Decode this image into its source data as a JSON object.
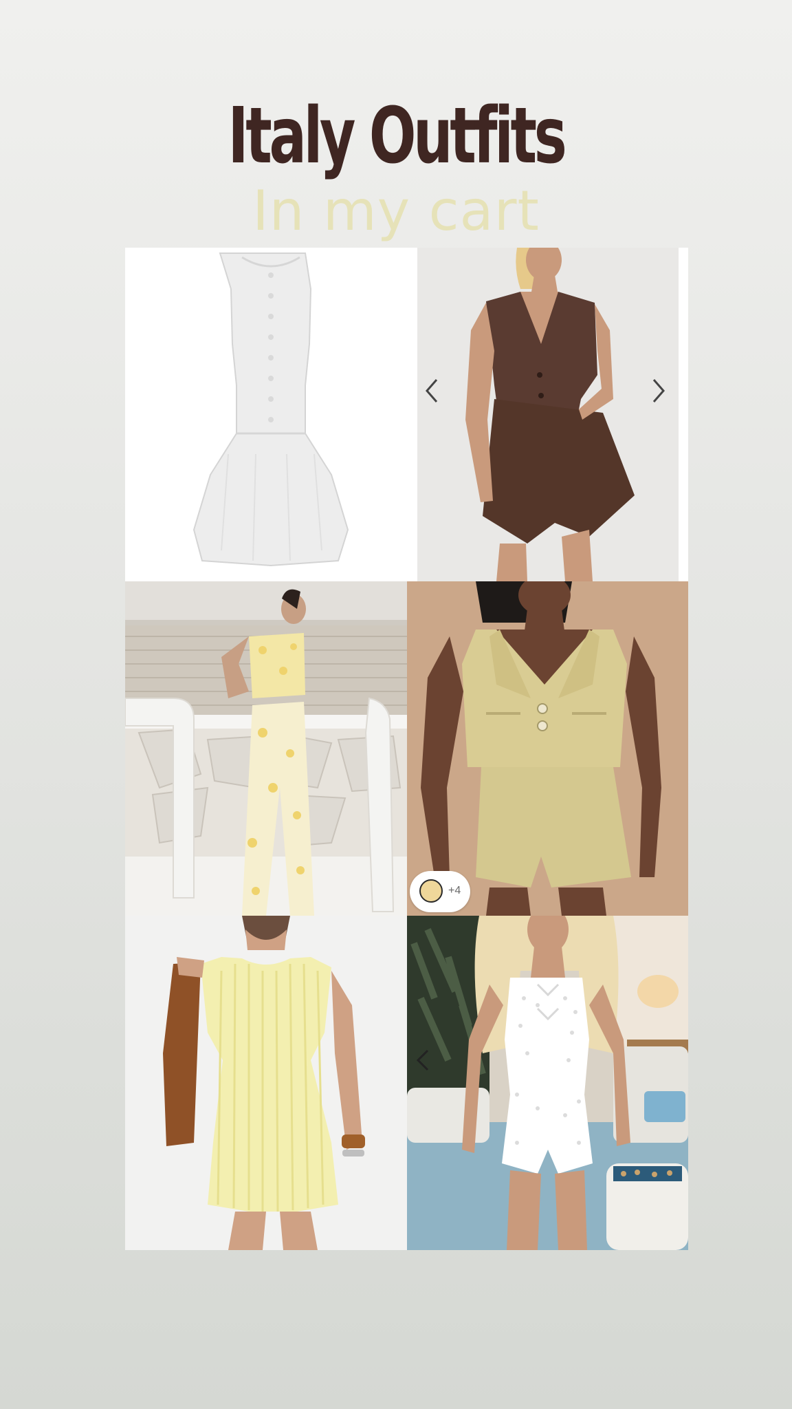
{
  "header": {
    "title": "Italy Outfits",
    "subtitle": "In my cart"
  },
  "colors": {
    "title": "#3f2622",
    "subtitle": "#e6e2b8",
    "background_top": "#f0f0ee",
    "background_bottom": "#d5d8d3"
  },
  "products": [
    {
      "name": "white sleeveless button-front mini dress",
      "icon": "product-photo"
    },
    {
      "name": "brown vest and shorts set",
      "icon": "product-photo",
      "carousel": true
    },
    {
      "name": "yellow floral tube top and wide-leg pants set",
      "icon": "product-photo"
    },
    {
      "name": "beige tweed vest and shorts set",
      "icon": "product-photo",
      "swatch_color": "#efd79a",
      "swatch_more": "+4"
    },
    {
      "name": "pale yellow striped mini dress",
      "icon": "product-photo"
    },
    {
      "name": "white eyelet tie-front romper",
      "icon": "product-photo",
      "carousel": true
    }
  ]
}
